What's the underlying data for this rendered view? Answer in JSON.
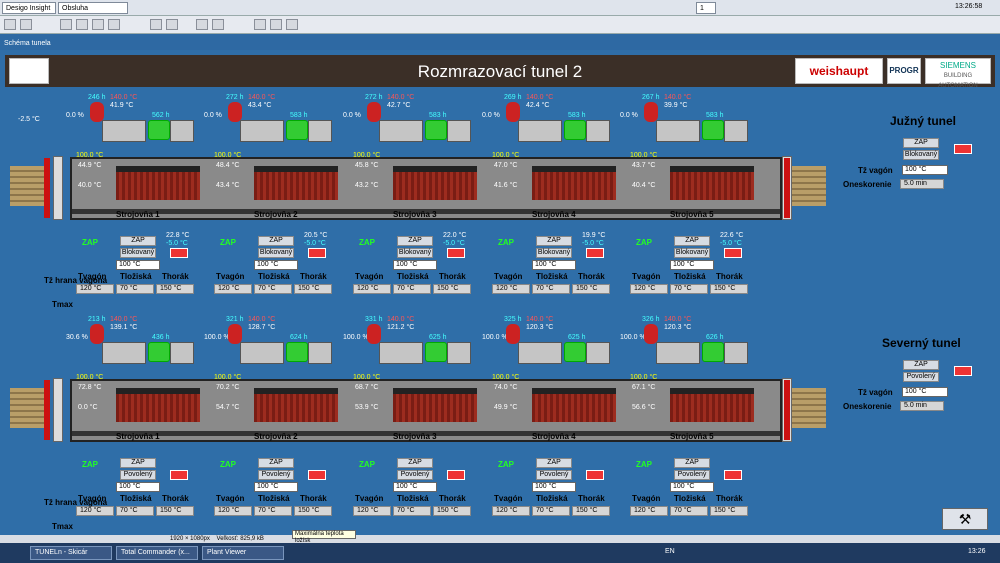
{
  "app": {
    "name": "Desigo Insight",
    "user": "Obsluha",
    "clock": "13:26:58",
    "page_indicator": "1"
  },
  "window": {
    "doc_title": "Schéma tunela"
  },
  "header": {
    "title": "Rozmrazovací tunel 2",
    "logo_left": "",
    "logo_weishaupt": "weishaupt",
    "logo_progr": "PROGR",
    "logo_siemens_1": "SIEMENS",
    "logo_siemens_2": "BUILDING AUTOMATION"
  },
  "south": {
    "name": "Južný tunel",
    "zap": "ZAP",
    "blok": "Blokovaný",
    "tz_label": "Tž vagón",
    "tz_val": "100 °C",
    "nesk_label": "Oneskorenie",
    "nesk_val": "5.0 min",
    "ambient": "-2.5 °C",
    "units": [
      {
        "sfan": "246 h",
        "sp": "140.0 °C",
        "t": "41.9 °C",
        "pct": "0.0 %",
        "pump": "562 h",
        "top": "100.0 °C",
        "mid": "44.9 °C",
        "low": "40.0 °C",
        "name": "Strojovňa 1",
        "zap": "ZAP",
        "zbtn": "ZAP",
        "blk": "Blokovaný",
        "r1": "22.8 °C",
        "r2": "-5.0 °C",
        "hrana": "100 °C",
        "tv": "120 °C",
        "tl": "70 °C",
        "th": "150 °C"
      },
      {
        "sfan": "272 h",
        "sp": "140.0 °C",
        "t": "43.4 °C",
        "pct": "0.0 %",
        "pump": "583 h",
        "top": "100.0 °C",
        "mid": "48.4 °C",
        "low": "43.4 °C",
        "name": "Strojovňa 2",
        "zap": "ZAP",
        "zbtn": "ZAP",
        "blk": "Blokovaný",
        "r1": "20.5 °C",
        "r2": "-5.0 °C",
        "hrana": "100 °C",
        "tv": "120 °C",
        "tl": "70 °C",
        "th": "150 °C"
      },
      {
        "sfan": "272 h",
        "sp": "140.0 °C",
        "t": "42.7 °C",
        "pct": "0.0 %",
        "pump": "583 h",
        "top": "100.0 °C",
        "mid": "45.8 °C",
        "low": "43.2 °C",
        "name": "Strojovňa 3",
        "zap": "ZAP",
        "zbtn": "ZAP",
        "blk": "Blokovaný",
        "r1": "22.0 °C",
        "r2": "-5.0 °C",
        "hrana": "100 °C",
        "tv": "120 °C",
        "tl": "70 °C",
        "th": "150 °C"
      },
      {
        "sfan": "269 h",
        "sp": "140.0 °C",
        "t": "42.4 °C",
        "pct": "0.0 %",
        "pump": "583 h",
        "top": "100.0 °C",
        "mid": "47.0 °C",
        "low": "41.6 °C",
        "name": "Strojovňa 4",
        "zap": "ZAP",
        "zbtn": "ZAP",
        "blk": "Blokovaný",
        "r1": "19.9 °C",
        "r2": "-5.0 °C",
        "hrana": "100 °C",
        "tv": "120 °C",
        "tl": "70 °C",
        "th": "150 °C"
      },
      {
        "sfan": "267 h",
        "sp": "140.0 °C",
        "t": "39.9 °C",
        "pct": "0.0 %",
        "pump": "583 h",
        "top": "100.0 °C",
        "mid": "43.7 °C",
        "low": "40.4 °C",
        "name": "Strojovňa 5",
        "zap": "ZAP",
        "zbtn": "ZAP",
        "blk": "Blokovaný",
        "r1": "22.6 °C",
        "r2": "-5.0 °C",
        "hrana": "100 °C",
        "tv": "120 °C",
        "tl": "70 °C",
        "th": "150 °C"
      }
    ]
  },
  "north": {
    "name": "Severný tunel",
    "zap": "ZAP",
    "blk": "Povolený",
    "tz_label": "Tž vagón",
    "tz_val": "100 °C",
    "nesk_label": "Oneskorenie",
    "nesk_val": "5.0 min",
    "units": [
      {
        "sfan": "213 h",
        "sp": "140.0 °C",
        "t": "139.1 °C",
        "pct": "30.6 %",
        "pump": "436 h",
        "top": "100.0 °C",
        "mid": "72.8 °C",
        "low": "0.0 °C",
        "name": "Strojovňa 1",
        "zap": "ZAP",
        "zbtn": "ZAP",
        "blk": "Povolený",
        "hrana": "100 °C",
        "tv": "120 °C",
        "tl": "70 °C",
        "th": "150 °C"
      },
      {
        "sfan": "321 h",
        "sp": "140.0 °C",
        "t": "128.7 °C",
        "pct": "100.0 %",
        "pump": "624 h",
        "top": "100.0 °C",
        "mid": "70.2 °C",
        "low": "54.7 °C",
        "name": "Strojovňa 2",
        "zap": "ZAP",
        "zbtn": "ZAP",
        "blk": "Povolený",
        "hrana": "100 °C",
        "tv": "120 °C",
        "tl": "70 °C",
        "th": "150 °C"
      },
      {
        "sfan": "331 h",
        "sp": "140.0 °C",
        "t": "121.2 °C",
        "pct": "100.0 %",
        "pump": "625 h",
        "top": "100.0 °C",
        "mid": "68.7 °C",
        "low": "53.9 °C",
        "name": "Strojovňa 3",
        "zap": "ZAP",
        "zbtn": "ZAP",
        "blk": "Povolený",
        "hrana": "100 °C",
        "tv": "120 °C",
        "tl": "70 °C",
        "th": "150 °C"
      },
      {
        "sfan": "325 h",
        "sp": "140.0 °C",
        "t": "120.3 °C",
        "pct": "100.0 %",
        "pump": "625 h",
        "top": "100.0 °C",
        "mid": "74.0 °C",
        "low": "49.9 °C",
        "name": "Strojovňa 4",
        "zap": "ZAP",
        "zbtn": "ZAP",
        "blk": "Povolený",
        "hrana": "100 °C",
        "tv": "120 °C",
        "tl": "70 °C",
        "th": "150 °C"
      },
      {
        "sfan": "326 h",
        "sp": "140.0 °C",
        "t": "120.3 °C",
        "pct": "100.0 %",
        "pump": "626 h",
        "top": "100.0 °C",
        "mid": "67.1 °C",
        "low": "56.6 °C",
        "name": "Strojovňa 5",
        "zap": "ZAP",
        "zbtn": "ZAP",
        "blk": "Povolený",
        "hrana": "100 °C",
        "tv": "120 °C",
        "tl": "70 °C",
        "th": "150 °C"
      }
    ]
  },
  "labels": {
    "hrana": "Tž hrana vagóna",
    "tvagon": "Tvagón",
    "tloziska": "Tložiská",
    "thorak": "Thorák",
    "tmax": "Tmax"
  },
  "tooltip": "Maximálna teplota ložísk",
  "status": {
    "res": "1920 × 1080px",
    "size": "Veľkosť: 825,9 kB"
  },
  "taskbar": {
    "items": [
      "TUNELn - Skicár",
      "Total Commander (x...",
      "Plant Viewer"
    ],
    "lang": "EN",
    "time": "13:26"
  }
}
